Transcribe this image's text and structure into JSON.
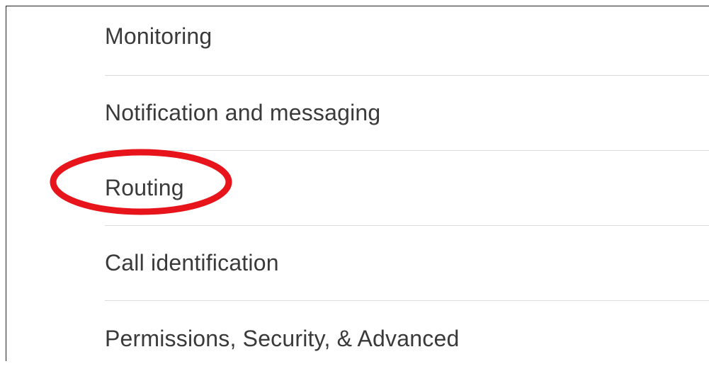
{
  "settings_menu": {
    "items": [
      {
        "label": "Monitoring"
      },
      {
        "label": "Notification and messaging"
      },
      {
        "label": "Routing",
        "highlighted": true
      },
      {
        "label": "Call identification"
      },
      {
        "label": "Permissions, Security, & Advanced"
      }
    ]
  },
  "annotation": {
    "shape": "ellipse",
    "target": "Routing",
    "color": "#e8141b"
  }
}
